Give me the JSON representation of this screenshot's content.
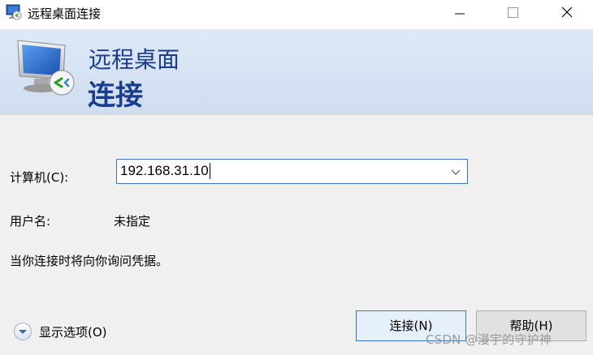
{
  "window": {
    "title": "远程桌面连接"
  },
  "banner": {
    "subtitle": "远程桌面",
    "title": "连接"
  },
  "form": {
    "computer_label": "计算机(C):",
    "computer_value": "192.168.31.10",
    "user_label": "用户名:",
    "user_value": "未指定",
    "info": "当你连接时将向你询问凭据。"
  },
  "footer": {
    "options_label": "显示选项(O)",
    "connect_label": "连接(N)",
    "help_label": "帮助(H)"
  },
  "watermark": "CSDN @漫宇的守护神",
  "icons": {
    "app": "remote-desktop-icon",
    "banner": "remote-desktop-monitor-icon",
    "options": "chevron-down-circle-icon",
    "combo": "chevron-down-icon"
  },
  "colors": {
    "accent": "#1a3d8e",
    "focus": "#3c74c4"
  }
}
